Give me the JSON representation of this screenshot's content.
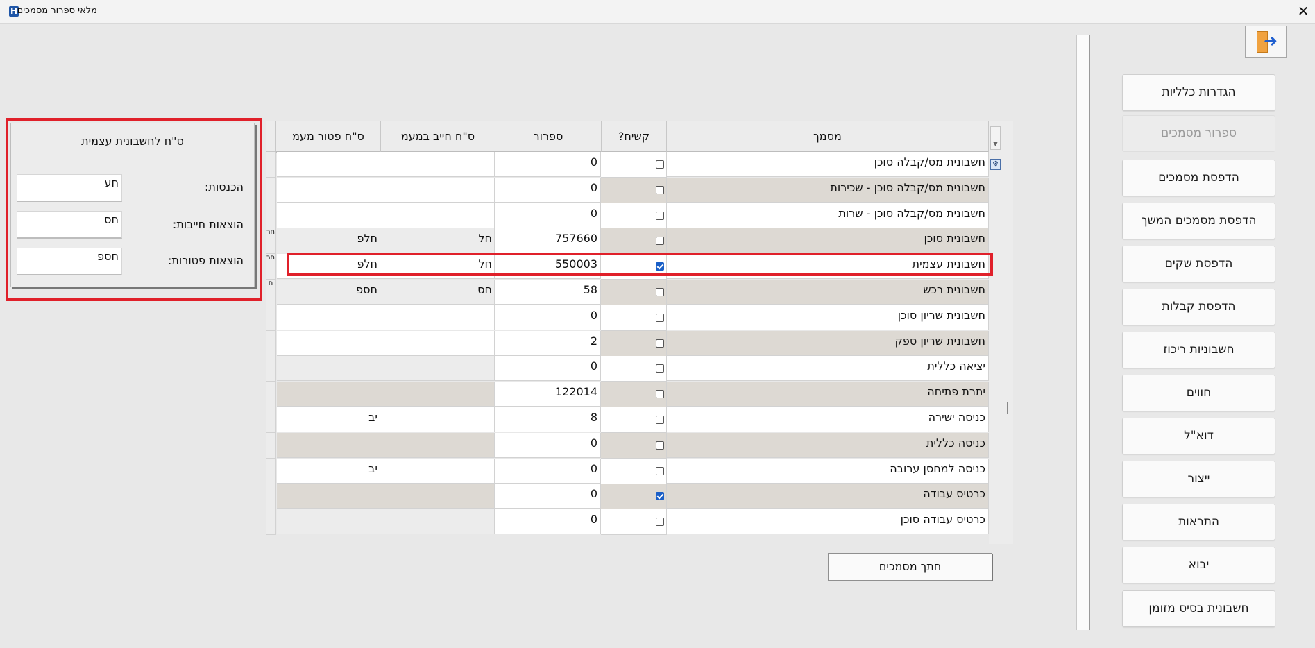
{
  "window": {
    "title": "מלאי ספרור מסמכים",
    "icon": "H"
  },
  "nav": {
    "items": [
      {
        "label": "הגדרות כלליות",
        "enabled": true
      },
      {
        "label": "ספרור מסמכים",
        "enabled": false
      },
      {
        "label": "הדפסת מסמכים",
        "enabled": true
      },
      {
        "label": "הדפסת מסמכים המשך",
        "enabled": true
      },
      {
        "label": "הדפסת שקים",
        "enabled": true
      },
      {
        "label": "הדפסת קבלות",
        "enabled": true
      },
      {
        "label": "חשבוניות ריכוז",
        "enabled": true
      },
      {
        "label": "חווים",
        "enabled": true
      },
      {
        "label": "דוא\"ל",
        "enabled": true
      },
      {
        "label": "ייצור",
        "enabled": true
      },
      {
        "label": "התראות",
        "enabled": true
      },
      {
        "label": "יבוא",
        "enabled": true
      },
      {
        "label": "חשבונית בסיס מזומן",
        "enabled": true
      }
    ]
  },
  "grid": {
    "columns": {
      "name": "מסמך",
      "hard": "קשיח?",
      "number": "ספרור",
      "liable": "ס\"ח חייב במעמ",
      "exempt": "ס\"ח פטור מעמ"
    },
    "rows": [
      {
        "name": "חשבונית מס/קבלה סוכן",
        "hard": false,
        "number": "0",
        "liable": "",
        "exempt": "",
        "side": ""
      },
      {
        "name": "חשבונית מס/קבלה סוכן - שכירות",
        "hard": false,
        "number": "0",
        "liable": "",
        "exempt": "",
        "side": ""
      },
      {
        "name": "חשבונית מס/קבלה סוכן - שרות",
        "hard": false,
        "number": "0",
        "liable": "",
        "exempt": "",
        "side": ""
      },
      {
        "name": "חשבונית סוכן",
        "hard": false,
        "number": "757660",
        "liable": "חל",
        "exempt": "חלפ",
        "side": "חר"
      },
      {
        "name": "חשבונית עצמית",
        "hard": true,
        "number": "550003",
        "liable": "חל",
        "exempt": "חלפ",
        "side": "חר"
      },
      {
        "name": "חשבונית רכש",
        "hard": false,
        "number": "58",
        "liable": "חס",
        "exempt": "חספ",
        "side": "ח"
      },
      {
        "name": "חשבונית שריון סוכן",
        "hard": false,
        "number": "0",
        "liable": "",
        "exempt": "",
        "side": ""
      },
      {
        "name": "חשבונית שריון ספק",
        "hard": false,
        "number": "2",
        "liable": "",
        "exempt": "",
        "side": ""
      },
      {
        "name": "יציאה כללית",
        "hard": false,
        "number": "0",
        "liable": "",
        "exempt": "",
        "side": ""
      },
      {
        "name": "יתרת פתיחה",
        "hard": false,
        "number": "122014",
        "liable": "",
        "exempt": "",
        "side": ""
      },
      {
        "name": "כניסה ישירה",
        "hard": false,
        "number": "8",
        "liable": "",
        "exempt": "יב",
        "side": ""
      },
      {
        "name": "כניסה כללית",
        "hard": false,
        "number": "0",
        "liable": "",
        "exempt": "",
        "side": ""
      },
      {
        "name": "כניסה למחסן ערובה",
        "hard": false,
        "number": "0",
        "liable": "",
        "exempt": "יב",
        "side": ""
      },
      {
        "name": "כרטיס עבודה",
        "hard": true,
        "number": "0",
        "liable": "",
        "exempt": "",
        "side": ""
      },
      {
        "name": "כרטיס עבודה סוכן",
        "hard": false,
        "number": "0",
        "liable": "",
        "exempt": "",
        "side": ""
      }
    ]
  },
  "summary": {
    "title": "ס\"ח לחשבונית עצמית",
    "income_label": "הכנסות:",
    "income_value": "חע",
    "liable_label": "הוצאות חייבות:",
    "liable_value": "חס",
    "exempt_label": "הוצאות פטורות:",
    "exempt_value": "חספ"
  },
  "filter_button": "חתך מסמכים",
  "colors": {
    "highlight": "#e0202a",
    "checkbox_on": "#1a5fc7",
    "row_alt": "#ddd9d3"
  }
}
